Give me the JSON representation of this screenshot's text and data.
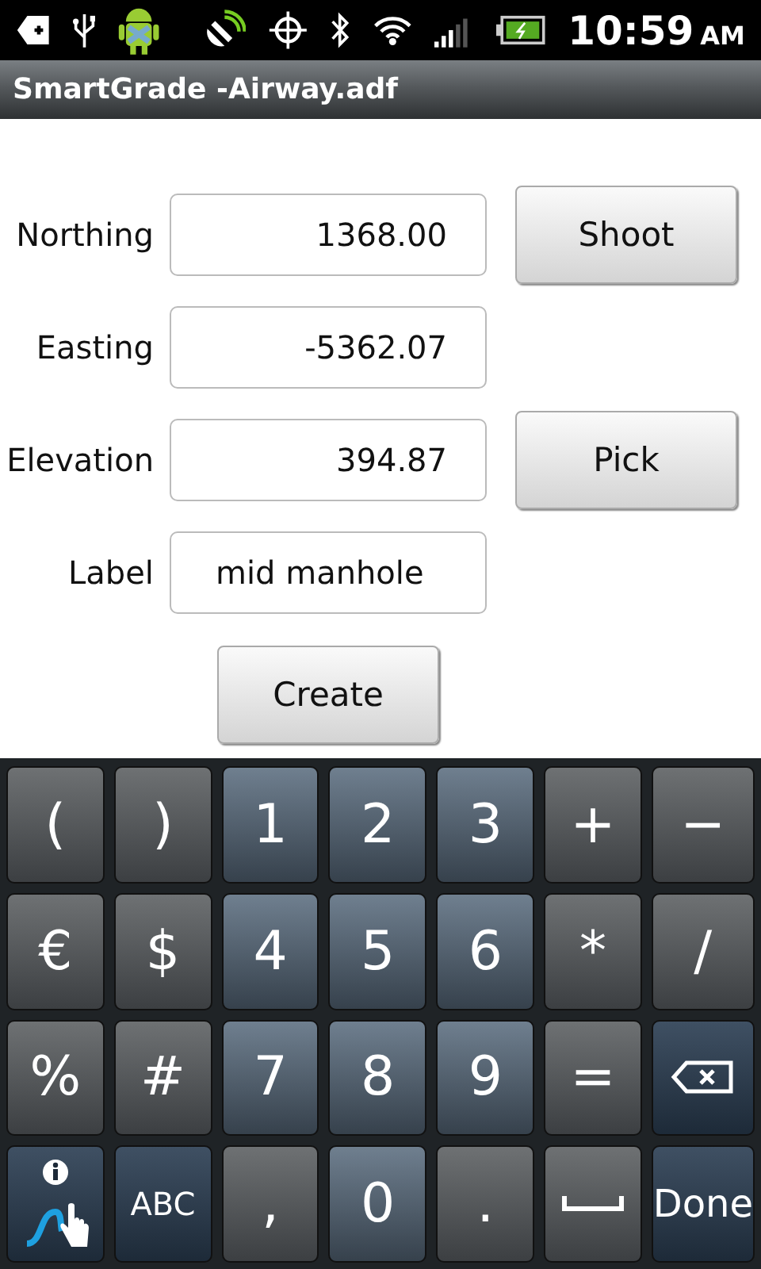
{
  "status_bar": {
    "time": "10:59",
    "meridiem": "AM"
  },
  "title_bar": {
    "title": "SmartGrade -Airway.adf"
  },
  "form": {
    "fields": [
      {
        "kind": "number",
        "label": "Northing",
        "value": "1368.00",
        "action": "Shoot"
      },
      {
        "kind": "number",
        "label": "Easting",
        "value": "-5362.07"
      },
      {
        "kind": "number",
        "label": "Elevation",
        "value": "394.87",
        "action": "Pick"
      },
      {
        "kind": "text",
        "label": "Label",
        "value": "mid manhole"
      }
    ],
    "submit": "Create"
  },
  "keyboard": {
    "rows": [
      [
        {
          "kind": "symbol",
          "label": "("
        },
        {
          "kind": "symbol",
          "label": ")"
        },
        {
          "kind": "digit",
          "label": "1"
        },
        {
          "kind": "digit",
          "label": "2"
        },
        {
          "kind": "digit",
          "label": "3"
        },
        {
          "kind": "symbol",
          "label": "+"
        },
        {
          "kind": "symbol",
          "label": "−"
        }
      ],
      [
        {
          "kind": "symbol",
          "label": "€"
        },
        {
          "kind": "symbol",
          "label": "$"
        },
        {
          "kind": "digit",
          "label": "4"
        },
        {
          "kind": "digit",
          "label": "5"
        },
        {
          "kind": "digit",
          "label": "6"
        },
        {
          "kind": "symbol",
          "label": "*"
        },
        {
          "kind": "symbol",
          "label": "/"
        }
      ],
      [
        {
          "kind": "symbol",
          "label": "%"
        },
        {
          "kind": "symbol",
          "label": "#"
        },
        {
          "kind": "digit",
          "label": "7"
        },
        {
          "kind": "digit",
          "label": "8"
        },
        {
          "kind": "digit",
          "label": "9"
        },
        {
          "kind": "symbol",
          "label": "="
        },
        {
          "kind": "backspace"
        }
      ],
      [
        {
          "kind": "swype"
        },
        {
          "kind": "action",
          "label": "ABC"
        },
        {
          "kind": "symbol",
          "label": ","
        },
        {
          "kind": "digit",
          "label": "0"
        },
        {
          "kind": "symbol",
          "label": "."
        },
        {
          "kind": "space"
        },
        {
          "kind": "action",
          "label": "Done"
        }
      ]
    ]
  }
}
